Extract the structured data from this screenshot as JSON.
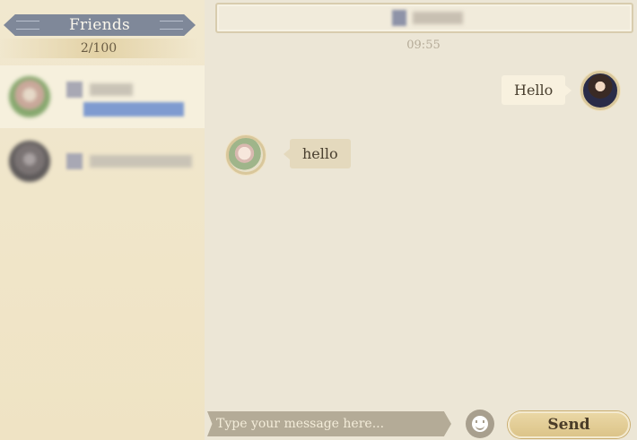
{
  "sidebar": {
    "title": "Friends",
    "friend_count": "2/100",
    "friends": [
      {
        "selected": true,
        "avatar_colors": [
          "#c9a89a",
          "#86a86e",
          "#e6d9c8"
        ],
        "name_width": 48
      },
      {
        "selected": false,
        "avatar_colors": [
          "#5e5a5a",
          "#7a7373",
          "#a9a2a2"
        ],
        "name_width": 114
      }
    ]
  },
  "chat": {
    "timestamp": "09:55",
    "messages": [
      {
        "sender": "me",
        "text": "Hello"
      },
      {
        "sender": "friend",
        "text": "hello"
      }
    ]
  },
  "input": {
    "placeholder": "Type your message here...",
    "value": ""
  },
  "buttons": {
    "send_label": "Send",
    "emoji_icon": "smiley-face-icon"
  },
  "colors": {
    "background": "#ece6d6",
    "sidebar": "#f1e8cf",
    "banner": "#7f8899",
    "send_button": "#e3cf98",
    "input_bar": "#b4ab97"
  }
}
